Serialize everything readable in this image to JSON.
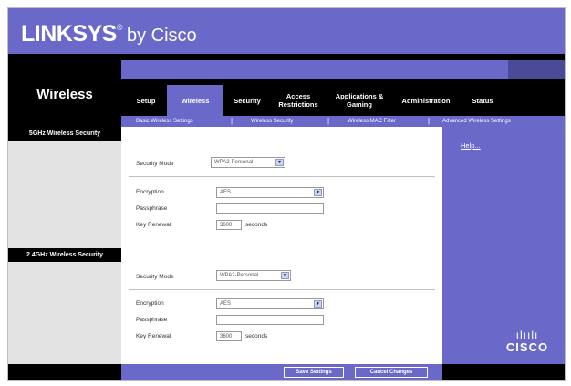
{
  "brand": {
    "logo": "LINKSYS",
    "registered": "®",
    "by": "by Cisco"
  },
  "section_title": "Wireless",
  "tabs": [
    {
      "label": "Setup",
      "active": false
    },
    {
      "label": "Wireless",
      "active": true
    },
    {
      "label": "Security",
      "active": false
    },
    {
      "label": "Access Restrictions",
      "active": false
    },
    {
      "label": "Applications & Gaming",
      "active": false
    },
    {
      "label": "Administration",
      "active": false
    },
    {
      "label": "Status",
      "active": false
    }
  ],
  "subnav": [
    "Basic Wireless Settings",
    "Wireless Security",
    "Wireless MAC Filter",
    "Advanced Wireless Settings"
  ],
  "subnav_sep": "|",
  "section_5g": {
    "heading": "5GHz Wireless Security",
    "security_mode_label": "Security Mode",
    "security_mode_value": "WPA2-Personal",
    "encryption_label": "Encryption",
    "encryption_value": "AES",
    "passphrase_label": "Passphrase",
    "passphrase_value": "",
    "key_renewal_label": "Key Renewal",
    "key_renewal_value": "3600",
    "key_renewal_unit": "seconds"
  },
  "section_24g": {
    "heading": "2.4GHz Wireless Security",
    "security_mode_label": "Security Mode",
    "security_mode_value": "WPA2-Personal",
    "encryption_label": "Encryption",
    "encryption_value": "AES",
    "passphrase_label": "Passphrase",
    "passphrase_value": "",
    "key_renewal_label": "Key Renewal",
    "key_renewal_value": "3600",
    "key_renewal_unit": "seconds"
  },
  "help_link": "Help...",
  "buttons": {
    "save": "Save Settings",
    "cancel": "Cancel Changes"
  },
  "cisco_logo": {
    "bars": "ılıılı",
    "word": "CISCO"
  },
  "colors": {
    "accent": "#6a69c9",
    "dark": "#000000",
    "band": "#e3e3e3"
  },
  "icons": {
    "dropdown": "chevron-down-icon"
  }
}
